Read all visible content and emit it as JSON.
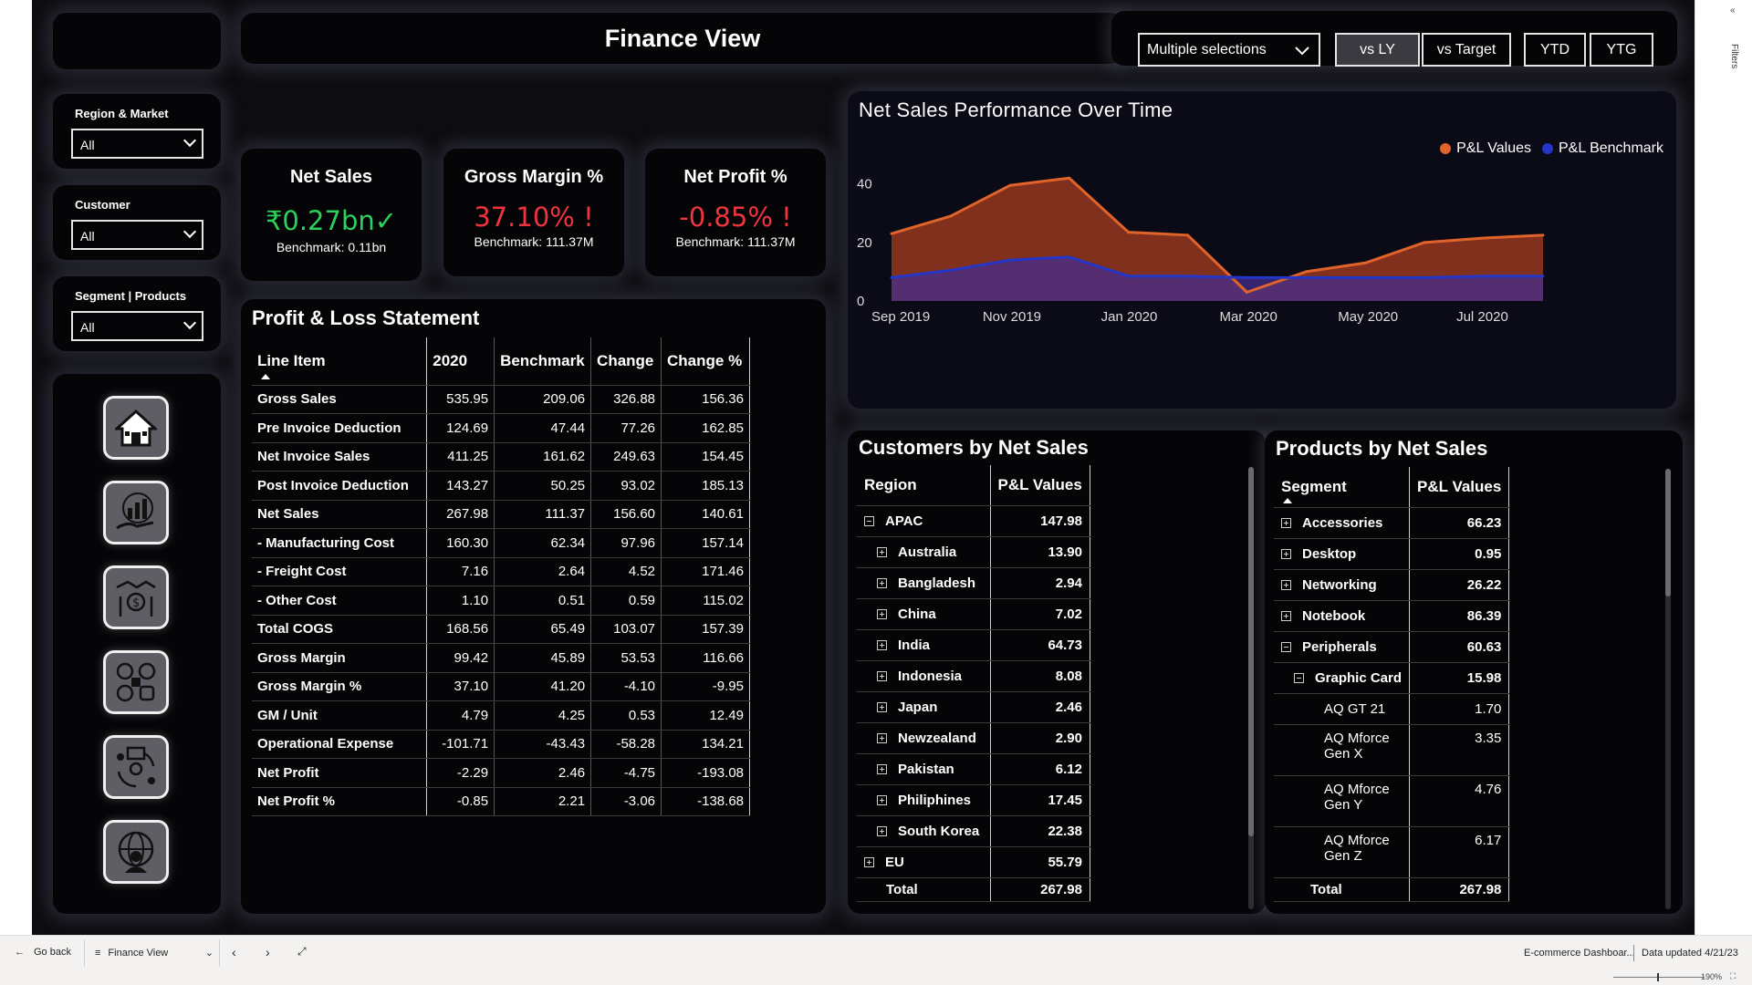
{
  "header": {
    "title": "Finance View"
  },
  "top_controls": {
    "selection_dropdown": "Multiple selections",
    "buttons": [
      "vs LY",
      "vs Target",
      "YTD",
      "YTG"
    ],
    "active_button": "vs LY"
  },
  "filters": [
    {
      "label": "Region & Market",
      "value": "All"
    },
    {
      "label": "Customer",
      "value": "All"
    },
    {
      "label": "Segment | Products",
      "value": "All"
    }
  ],
  "nav_icons": [
    "home-icon",
    "analytics-hand-icon",
    "handshake-money-icon",
    "social-media-icon",
    "supply-chain-icon",
    "global-person-icon"
  ],
  "kpis": [
    {
      "title": "Net Sales",
      "value": "₹0.27bn✓",
      "benchmark": "Benchmark: 0.11bn",
      "color": "#2bd15a"
    },
    {
      "title": "Gross Margin %",
      "value": "37.10% !",
      "benchmark": "Benchmark: 111.37M",
      "color": "#f0343f"
    },
    {
      "title": "Net Profit %",
      "value": "-0.85% !",
      "benchmark": "Benchmark: 111.37M",
      "color": "#f0343f"
    }
  ],
  "pl": {
    "title": "Profit & Loss Statement",
    "columns": [
      "Line Item",
      "2020",
      "Benchmark",
      "Change",
      "Change %"
    ],
    "rows": [
      [
        "Gross Sales",
        "535.95",
        "209.06",
        "326.88",
        "156.36"
      ],
      [
        "Pre Invoice Deduction",
        "124.69",
        "47.44",
        "77.26",
        "162.85"
      ],
      [
        "Net Invoice Sales",
        "411.25",
        "161.62",
        "249.63",
        "154.45"
      ],
      [
        "Post Invoice Deduction",
        "143.27",
        "50.25",
        "93.02",
        "185.13"
      ],
      [
        "Net Sales",
        "267.98",
        "111.37",
        "156.60",
        "140.61"
      ],
      [
        "- Manufacturing Cost",
        "160.30",
        "62.34",
        "97.96",
        "157.14"
      ],
      [
        "- Freight Cost",
        "7.16",
        "2.64",
        "4.52",
        "171.46"
      ],
      [
        "- Other Cost",
        "1.10",
        "0.51",
        "0.59",
        "115.02"
      ],
      [
        "Total COGS",
        "168.56",
        "65.49",
        "103.07",
        "157.39"
      ],
      [
        "Gross Margin",
        "99.42",
        "45.89",
        "53.53",
        "116.66"
      ],
      [
        "Gross Margin %",
        "37.10",
        "41.20",
        "-4.10",
        "-9.95"
      ],
      [
        "GM / Unit",
        "4.79",
        "4.25",
        "0.53",
        "12.49"
      ],
      [
        "Operational Expense",
        "-101.71",
        "-43.43",
        "-58.28",
        "134.21"
      ],
      [
        "Net Profit",
        "-2.29",
        "2.46",
        "-4.75",
        "-193.08"
      ],
      [
        "Net Profit %",
        "-0.85",
        "2.21",
        "-3.06",
        "-138.68"
      ]
    ]
  },
  "chart": {
    "title": "Net Sales Performance Over Time",
    "legend": [
      "P&L Values",
      "P&L Benchmark"
    ],
    "colors": {
      "values": "#e0642a",
      "benchmark": "#2436c8"
    }
  },
  "chart_data": {
    "type": "area",
    "title": "Net Sales Performance Over Time",
    "x": [
      "Sep 2019",
      "Oct 2019",
      "Nov 2019",
      "Dec 2019",
      "Jan 2020",
      "Feb 2020",
      "Mar 2020",
      "Apr 2020",
      "May 2020",
      "Jun 2020",
      "Jul 2020",
      "Aug 2020"
    ],
    "x_tick_labels": [
      "Sep 2019",
      "Nov 2019",
      "Jan 2020",
      "Mar 2020",
      "May 2020",
      "Jul 2020"
    ],
    "y_tick_labels": [
      "0",
      "20",
      "40"
    ],
    "ylim": [
      0,
      48
    ],
    "series": [
      {
        "name": "P&L Values",
        "values": [
          23,
          29,
          39.5,
          42,
          23.5,
          22.5,
          3,
          10,
          13,
          20,
          21.5,
          22.5
        ]
      },
      {
        "name": "P&L Benchmark",
        "values": [
          8,
          10.5,
          14,
          15,
          8.5,
          8.5,
          8,
          8,
          8,
          8,
          8.5,
          8.5
        ]
      }
    ],
    "legend_position": "top-right",
    "grid": false
  },
  "customers": {
    "title": "Customers by Net Sales",
    "columns": [
      "Region",
      "P&L Values"
    ],
    "rows": [
      {
        "label": "APAC",
        "value": "147.98",
        "level": 0,
        "expander": "minus"
      },
      {
        "label": "Australia",
        "value": "13.90",
        "level": 1,
        "expander": "plus"
      },
      {
        "label": "Bangladesh",
        "value": "2.94",
        "level": 1,
        "expander": "plus"
      },
      {
        "label": "China",
        "value": "7.02",
        "level": 1,
        "expander": "plus"
      },
      {
        "label": "India",
        "value": "64.73",
        "level": 1,
        "expander": "plus"
      },
      {
        "label": "Indonesia",
        "value": "8.08",
        "level": 1,
        "expander": "plus"
      },
      {
        "label": "Japan",
        "value": "2.46",
        "level": 1,
        "expander": "plus"
      },
      {
        "label": "Newzealand",
        "value": "2.90",
        "level": 1,
        "expander": "plus"
      },
      {
        "label": "Pakistan",
        "value": "6.12",
        "level": 1,
        "expander": "plus"
      },
      {
        "label": "Philiphines",
        "value": "17.45",
        "level": 1,
        "expander": "plus"
      },
      {
        "label": "South Korea",
        "value": "22.38",
        "level": 1,
        "expander": "plus"
      },
      {
        "label": "EU",
        "value": "55.79",
        "level": 0,
        "expander": "plus"
      }
    ],
    "total_label": "Total",
    "total_value": "267.98"
  },
  "products": {
    "title": "Products by Net Sales",
    "columns": [
      "Segment",
      "P&L Values"
    ],
    "rows": [
      {
        "label": "Accessories",
        "value": "66.23",
        "level": 0,
        "expander": "plus",
        "bold": true
      },
      {
        "label": "Desktop",
        "value": "0.95",
        "level": 0,
        "expander": "plus",
        "bold": true
      },
      {
        "label": "Networking",
        "value": "26.22",
        "level": 0,
        "expander": "plus",
        "bold": true
      },
      {
        "label": "Notebook",
        "value": "86.39",
        "level": 0,
        "expander": "plus",
        "bold": true
      },
      {
        "label": "Peripherals",
        "value": "60.63",
        "level": 0,
        "expander": "minus",
        "bold": true
      },
      {
        "label": "Graphic Card",
        "value": "15.98",
        "level": 1,
        "expander": "minus",
        "bold": true
      },
      {
        "label": "AQ GT 21",
        "value": "1.70",
        "level": 2,
        "expander": "",
        "bold": false
      },
      {
        "label": "AQ Mforce Gen X",
        "value": "3.35",
        "level": 2,
        "expander": "",
        "bold": false
      },
      {
        "label": "AQ Mforce Gen Y",
        "value": "4.76",
        "level": 2,
        "expander": "",
        "bold": false
      },
      {
        "label": "AQ Mforce Gen Z",
        "value": "6.17",
        "level": 2,
        "expander": "",
        "bold": false
      }
    ],
    "total_label": "Total",
    "total_value": "267.98"
  },
  "bottombar": {
    "go_back": "Go back",
    "page": "Finance View",
    "report_name": "E-commerce Dashboar...",
    "data_updated": "Data updated 4/21/23",
    "zoom": "190%"
  },
  "right_pane": {
    "filters_label": "Filters"
  }
}
